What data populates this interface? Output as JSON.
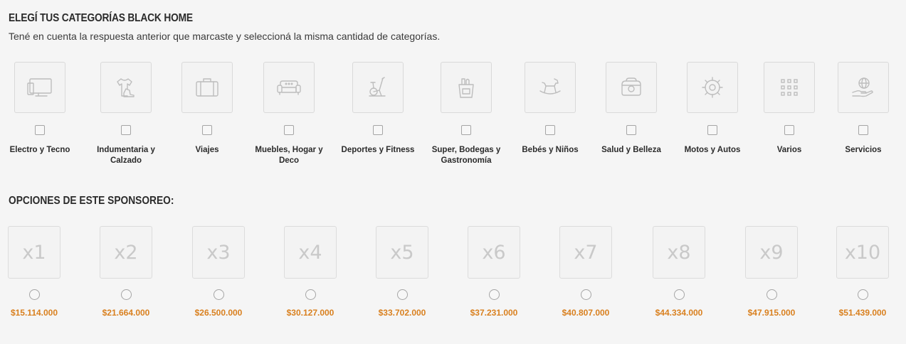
{
  "header": {
    "title": "ELEGÍ TUS CATEGORÍAS BLACK HOME",
    "subtitle": "Tené en cuenta la respuesta anterior que marcaste y seleccioná la misma cantidad de categorías."
  },
  "categories": [
    {
      "label": "Electro y Tecno",
      "icon": "tv-monitor-icon"
    },
    {
      "label": "Indumentaria y Calzado",
      "icon": "clothing-icon"
    },
    {
      "label": "Viajes",
      "icon": "suitcase-icon"
    },
    {
      "label": "Muebles, Hogar y Deco",
      "icon": "sofa-icon"
    },
    {
      "label": "Deportes y Fitness",
      "icon": "exercise-bike-icon"
    },
    {
      "label": "Super, Bodegas y Gastronomía",
      "icon": "grocery-bag-icon"
    },
    {
      "label": "Bebés y Niños",
      "icon": "rocking-horse-icon"
    },
    {
      "label": "Salud y Belleza",
      "icon": "cosmetics-bag-icon"
    },
    {
      "label": "Motos y Autos",
      "icon": "gear-icon"
    },
    {
      "label": "Varios",
      "icon": "grid-icon"
    },
    {
      "label": "Servicios",
      "icon": "globe-hand-icon"
    }
  ],
  "options": {
    "title": "OPCIONES DE ESTE SPONSOREO:",
    "items": [
      {
        "mult": "x1",
        "price": "$15.114.000"
      },
      {
        "mult": "x2",
        "price": "$21.664.000"
      },
      {
        "mult": "x3",
        "price": "$26.500.000"
      },
      {
        "mult": "x4",
        "price": "$30.127.000"
      },
      {
        "mult": "x5",
        "price": "$33.702.000"
      },
      {
        "mult": "x6",
        "price": "$37.231.000"
      },
      {
        "mult": "x7",
        "price": "$40.807.000"
      },
      {
        "mult": "x8",
        "price": "$44.334.000"
      },
      {
        "mult": "x9",
        "price": "$47.915.000"
      },
      {
        "mult": "x10",
        "price": "$51.439.000"
      }
    ]
  },
  "colors": {
    "background": "#f5f5f5",
    "price": "#d9801f",
    "icon": "#bdbdbd"
  }
}
